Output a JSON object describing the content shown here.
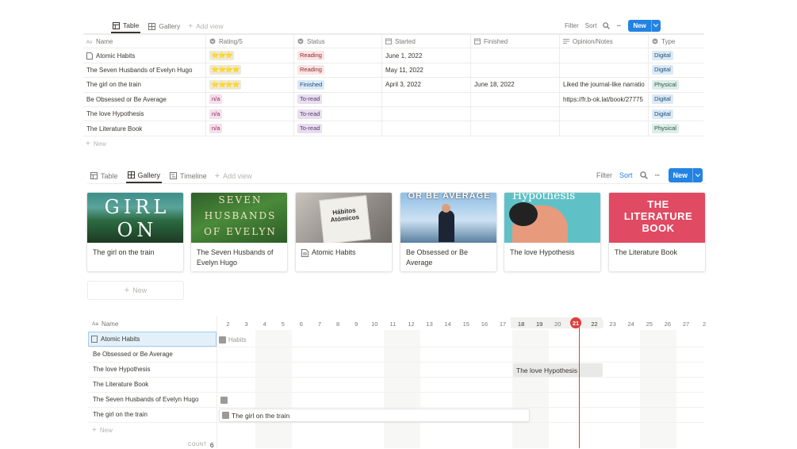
{
  "table_view": {
    "tabs": [
      {
        "label": "Table",
        "active": true
      },
      {
        "label": "Gallery",
        "active": false
      }
    ],
    "add_view": "Add view",
    "toolbar": {
      "filter": "Filter",
      "sort": "Sort",
      "new": "New"
    },
    "columns": [
      "Name",
      "Rating/5",
      "Status",
      "Started",
      "Finished",
      "Opinion/Notes",
      "Type"
    ],
    "rows": [
      {
        "name": "Atomic Habits",
        "rating": "⭐⭐⭐",
        "status": "Reading",
        "started": "June 1, 2022",
        "finished": "",
        "notes": "",
        "type": "Digital"
      },
      {
        "name": "The Seven Husbands of Evelyn Hugo",
        "rating": "⭐⭐⭐⭐",
        "status": "Reading",
        "started": "May 11, 2022",
        "finished": "",
        "notes": "",
        "type": "Digital"
      },
      {
        "name": "The girl on the train",
        "rating": "⭐⭐⭐⭐",
        "status": "Finished",
        "started": "April 3, 2022",
        "finished": "June 18, 2022",
        "notes": "Liked the journal-like narratio",
        "type": "Physical"
      },
      {
        "name": "Be Obsessed or Be Average",
        "rating": "n/a",
        "status": "To-read",
        "started": "",
        "finished": "",
        "notes": "https://fr.b-ok.lat/book/27775",
        "type": "Digital"
      },
      {
        "name": "The love Hypothesis",
        "rating": "n/a",
        "status": "To-read",
        "started": "",
        "finished": "",
        "notes": "",
        "type": "Digital"
      },
      {
        "name": "The Literature Book",
        "rating": "n/a",
        "status": "To-read",
        "started": "",
        "finished": "",
        "notes": "",
        "type": "Physical"
      }
    ],
    "new_row": "New"
  },
  "gallery_view": {
    "tabs": [
      {
        "label": "Table"
      },
      {
        "label": "Gallery",
        "active": true
      },
      {
        "label": "Timeline"
      }
    ],
    "add_view": "Add view",
    "toolbar": {
      "filter": "Filter",
      "sort": "Sort",
      "new": "New"
    },
    "cards": [
      {
        "title": "The girl on the train",
        "cover_text": "GIRL ON THE"
      },
      {
        "title": "The Seven Husbands of Evelyn Hugo",
        "cover_text": "SEVEN HUSBANDS OF EVELYN HUGO"
      },
      {
        "title": "Atomic Habits",
        "cover_text": "Hábitos Atómicos"
      },
      {
        "title": "Be Obsessed or Be Average",
        "cover_text": "OR BE AVERAGE"
      },
      {
        "title": "The love Hypothesis",
        "cover_text": "Hypothesis"
      },
      {
        "title": "The Literature Book",
        "cover_text": "THE LITERATURE BOOK"
      }
    ],
    "new_card": "New"
  },
  "timeline_view": {
    "name_header": "Name",
    "days": [
      "2",
      "3",
      "4",
      "5",
      "6",
      "7",
      "8",
      "9",
      "10",
      "11",
      "12",
      "13",
      "14",
      "15",
      "16",
      "17",
      "18",
      "19",
      "20",
      "21",
      "22",
      "23",
      "24",
      "25",
      "26",
      "27",
      "2"
    ],
    "today": "21",
    "rows": [
      "Atomic Habits",
      "Be Obsessed or Be Average",
      "The love Hypothesis",
      "The Literature Book",
      "The Seven Husbands of Evelyn Hugo",
      "The girl on the train"
    ],
    "bars": {
      "atomic": "Habits",
      "love": "The love Hypothesis",
      "girl": "The girl on the train"
    },
    "new_row": "New",
    "count_label": "COUNT",
    "count": "6"
  },
  "colors": {
    "accent": "#2383e2",
    "today": "#e03e3e"
  }
}
